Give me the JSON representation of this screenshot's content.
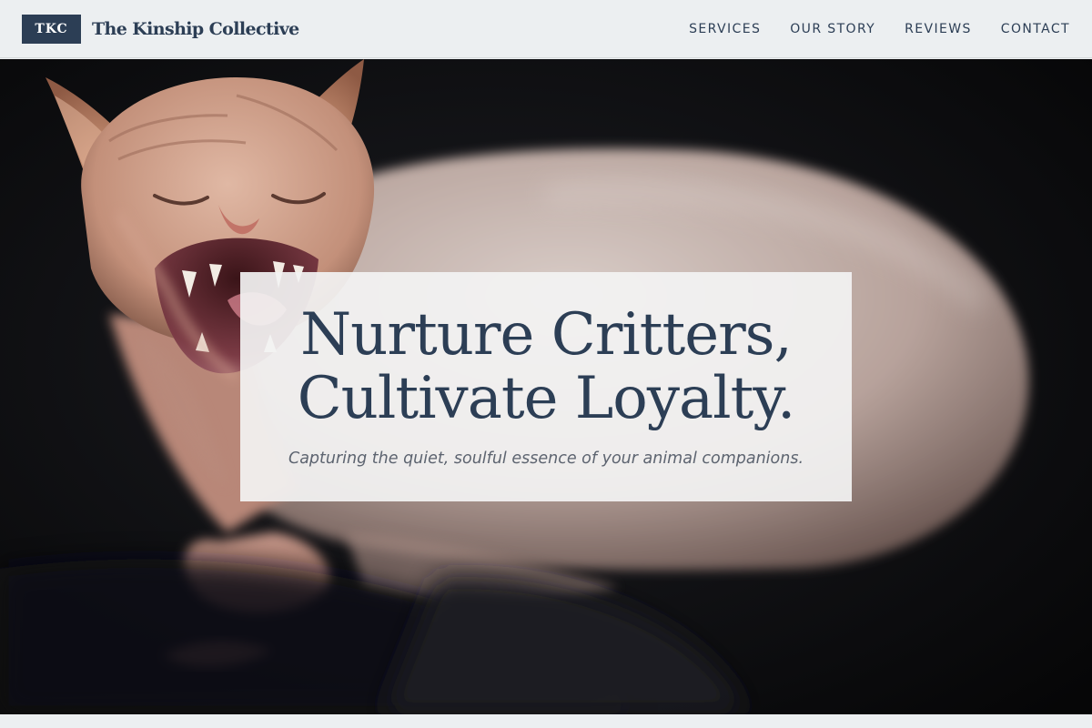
{
  "header": {
    "logo_badge": "TKC",
    "brand_name": "The Kinship Collective",
    "nav": {
      "services": "SERVICES",
      "our_story": "OUR STORY",
      "reviews": "REVIEWS",
      "contact": "CONTACT"
    }
  },
  "hero": {
    "title_line1": "Nurture Critters,",
    "title_line2": "Cultivate Loyalty.",
    "subtitle": "Capturing the quiet, soulful essence of your animal companions.",
    "image_subject": "hairless-sphynx-cat-yawning-photo"
  },
  "colors": {
    "brand_navy": "#2c3e55",
    "header_bg": "#eceff1",
    "card_bg": "#f3f3f3",
    "subtitle_gray": "#5d6470",
    "hero_dark": "#0b0b0d"
  }
}
